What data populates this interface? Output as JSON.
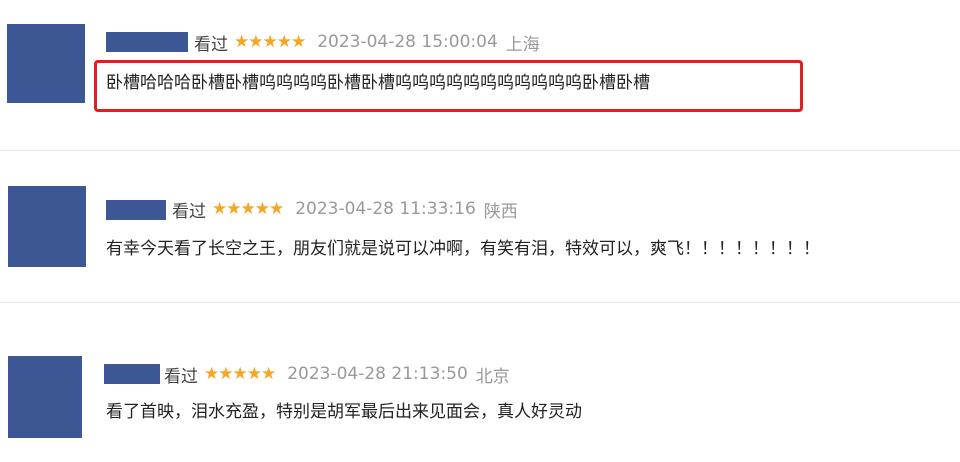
{
  "reviews": [
    {
      "status": "看过",
      "stars": "★★★★★",
      "time": "2023-04-28 15:00:04",
      "location": "上海",
      "comment": "卧槽哈哈哈卧槽卧槽呜呜呜呜卧槽卧槽呜呜呜呜呜呜呜呜呜呜呜卧槽卧槽",
      "highlighted": true
    },
    {
      "status": "看过",
      "stars": "★★★★★",
      "time": "2023-04-28 11:33:16",
      "location": "陕西",
      "comment": "有幸今天看了长空之王，朋友们就是说可以冲啊，有笑有泪，特效可以，爽飞！！！！！！！！"
    },
    {
      "status": "看过",
      "stars": "★★★★★",
      "time": "2023-04-28 21:13:50",
      "location": "北京",
      "comment": "看了首映，泪水充盈，特别是胡军最后出来见面会，真人好灵动"
    }
  ],
  "colors": {
    "avatar": "#3d5794",
    "star": "#f5a623",
    "highlight_border": "#e02020"
  }
}
